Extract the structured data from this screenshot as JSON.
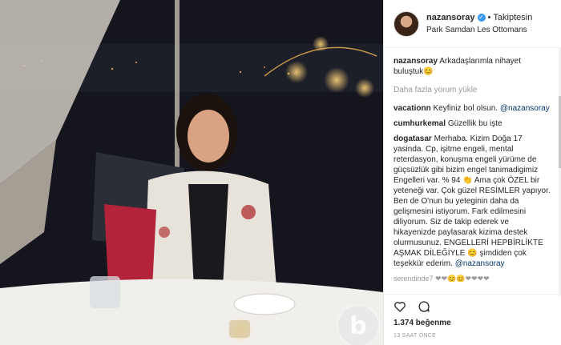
{
  "post": {
    "username": "nazansoray",
    "verified_icon": "check",
    "separator": "•",
    "follow_status": "Takiptesin",
    "location": "Park Samdan Les Ottomans"
  },
  "caption": {
    "username": "nazansoray",
    "text": "Arkadaşlarımla nihayet buluştuk😊"
  },
  "load_more": "Daha fazla yorum yükle",
  "comments": [
    {
      "username": "vacationn",
      "text": "Keyfiniz bol olsun.",
      "mention": "@nazansoray"
    },
    {
      "username": "cumhurkemal",
      "text": "Güzellik bu işte",
      "mention": ""
    },
    {
      "username": "dogatasar",
      "text": "Merhaba. Kizim Doğa 17 yasinda. Cp, işitme engeli, mental reterdasyon, konuşma engeli yürüme de güçsüzlük gibi bizim engel tanimadigimiz Engelleri var. % 94 👏 Ama çok ÖZEL bir yeteneği var. Çok güzel RESİMLER yapıyor. Ben de O'nun bu yeteginin daha da gelişmesini istiyorum. Fark edilmesini diliyorum. Siz de takip ederek ve hikayenizde paylasarak kizima destek olurmusunuz. ENGELLERİ HEPBİRLİKTE AŞMAK DİLEĞİYLE 😊 şimdiden çok teşekkür ederim.",
      "mention": "@nazansoray"
    }
  ],
  "partial_comment": "serendinde7 ❤❤😊😊❤❤❤❤",
  "actions": {
    "like_icon": "heart-icon",
    "comment_icon": "comment-icon"
  },
  "likes": "1.374 beğenme",
  "time_ago": "13 SAAT ÖNCE",
  "watermark": "b",
  "colors": {
    "link": "#003569",
    "verified": "#3897f0",
    "muted": "#999999"
  }
}
